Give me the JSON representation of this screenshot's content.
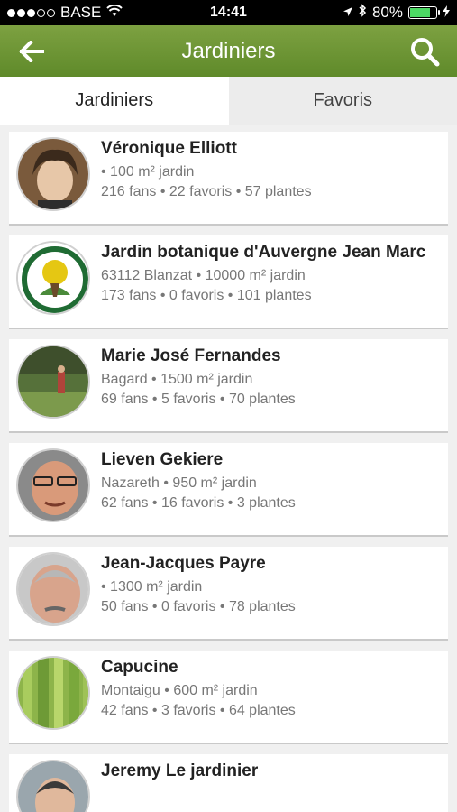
{
  "status_bar": {
    "carrier": "BASE",
    "time": "14:41",
    "battery": "80%",
    "battery_level": 0.8
  },
  "header": {
    "title": "Jardiniers",
    "back_icon": "arrow-left-icon",
    "search_icon": "search-icon"
  },
  "tabs": [
    {
      "label": "Jardiniers",
      "active": true
    },
    {
      "label": "Favoris",
      "active": false
    }
  ],
  "gardeners": [
    {
      "name": "Véronique Elliott",
      "line1": "• 100 m² jardin",
      "line2": "216 fans • 22 favoris • 57 plantes"
    },
    {
      "name": "Jardin botanique d'Auvergne Jean Marc",
      "line1": "63112 Blanzat • 10000 m² jardin",
      "line2": "173 fans • 0 favoris • 101 plantes"
    },
    {
      "name": "Marie José Fernandes",
      "line1": "Bagard • 1500 m² jardin",
      "line2": "69 fans • 5 favoris • 70 plantes"
    },
    {
      "name": "Lieven Gekiere",
      "line1": "Nazareth • 950 m² jardin",
      "line2": "62 fans • 16 favoris • 3 plantes"
    },
    {
      "name": "Jean-Jacques Payre",
      "line1": "• 1300 m² jardin",
      "line2": "50 fans • 0 favoris • 78 plantes"
    },
    {
      "name": "Capucine",
      "line1": "Montaigu • 600 m² jardin",
      "line2": "42 fans • 3 favoris • 64 plantes"
    },
    {
      "name": "Jeremy Le jardinier",
      "line1": "",
      "line2": ""
    }
  ],
  "colors": {
    "header_green": "#6b9433",
    "battery_green": "#4cd964"
  }
}
